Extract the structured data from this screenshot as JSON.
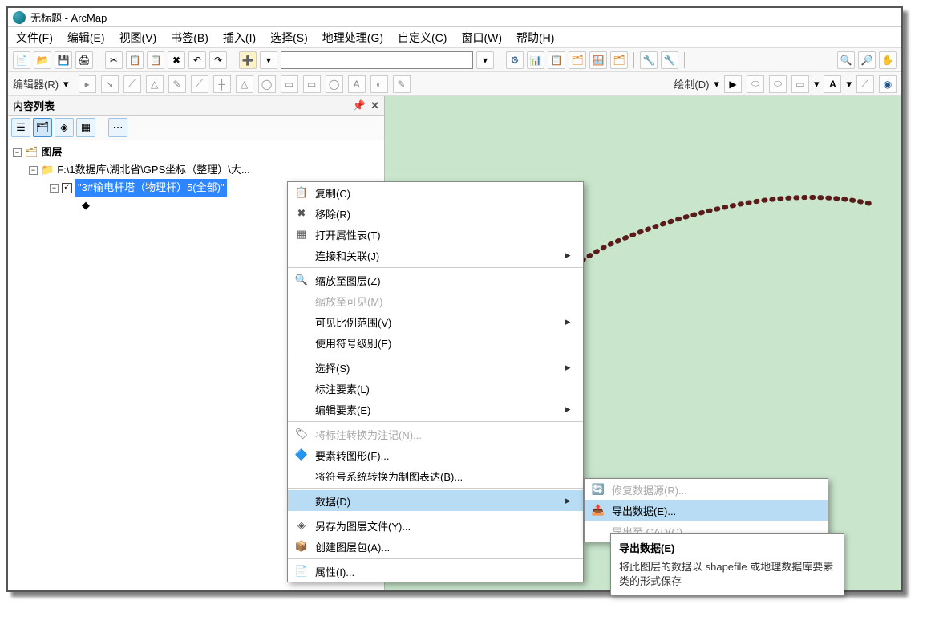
{
  "title": "无标题 - ArcMap",
  "menubar": [
    "文件(F)",
    "编辑(E)",
    "视图(V)",
    "书签(B)",
    "插入(I)",
    "选择(S)",
    "地理处理(G)",
    "自定义(C)",
    "窗口(W)",
    "帮助(H)"
  ],
  "toolbar1": {
    "btns": [
      "📄",
      "📂",
      "💾",
      "🖨",
      "✂",
      "📋",
      "📋",
      "✖",
      "↶",
      "↷",
      "➕",
      "",
      "",
      "",
      "⚙",
      "📊",
      "📋",
      "🗂",
      "🪟",
      "🗂",
      "🔧",
      "🔧",
      "",
      "",
      "🔍",
      "🔎"
    ],
    "scale_box": ""
  },
  "toolbar2": {
    "editor_label": "编辑器(R)",
    "draw_label": "绘制(D)",
    "mid_btns": [
      "▸",
      "↘",
      "⟋",
      "△",
      "✎",
      "⟋",
      "⟋",
      "┼",
      "△",
      "◯",
      "▭",
      "▭",
      "A",
      "◐",
      "✎",
      "□",
      "A"
    ]
  },
  "sidebar": {
    "title": "内容列表",
    "pin": "📌",
    "close": "✕",
    "tree": {
      "root": "图层",
      "path": "F:\\1数据库\\湖北省\\GPS坐标（整理）\\大...",
      "layer": "\"3#输电杆塔（物理杆）5(全部)\""
    }
  },
  "context_menu": {
    "items": [
      {
        "icon": "📋",
        "label": "复制(C)",
        "arrow": false,
        "disabled": false
      },
      {
        "icon": "✖",
        "label": "移除(R)",
        "arrow": false,
        "disabled": false
      },
      {
        "icon": "▦",
        "label": "打开属性表(T)",
        "arrow": false,
        "disabled": false
      },
      {
        "icon": "",
        "label": "连接和关联(J)",
        "arrow": true,
        "disabled": false
      },
      {
        "icon": "🔍",
        "label": "缩放至图层(Z)",
        "arrow": false,
        "disabled": false
      },
      {
        "icon": "",
        "label": "缩放至可见(M)",
        "arrow": false,
        "disabled": true
      },
      {
        "icon": "",
        "label": "可见比例范围(V)",
        "arrow": true,
        "disabled": false
      },
      {
        "icon": "",
        "label": "使用符号级别(E)",
        "arrow": false,
        "disabled": false
      },
      {
        "icon": "",
        "label": "选择(S)",
        "arrow": true,
        "disabled": false
      },
      {
        "icon": "",
        "label": "标注要素(L)",
        "arrow": false,
        "disabled": false
      },
      {
        "icon": "",
        "label": "编辑要素(E)",
        "arrow": true,
        "disabled": false
      },
      {
        "icon": "🏷",
        "label": "将标注转换为注记(N)...",
        "arrow": false,
        "disabled": true
      },
      {
        "icon": "🔷",
        "label": "要素转图形(F)...",
        "arrow": false,
        "disabled": false
      },
      {
        "icon": "",
        "label": "将符号系统转换为制图表达(B)...",
        "arrow": false,
        "disabled": false
      },
      {
        "icon": "",
        "label": "数据(D)",
        "arrow": true,
        "disabled": false,
        "selected": true
      },
      {
        "icon": "◈",
        "label": "另存为图层文件(Y)...",
        "arrow": false,
        "disabled": false
      },
      {
        "icon": "📦",
        "label": "创建图层包(A)...",
        "arrow": false,
        "disabled": false
      },
      {
        "icon": "📄",
        "label": "属性(I)...",
        "arrow": false,
        "disabled": false
      }
    ]
  },
  "submenu": {
    "items": [
      {
        "icon": "🔄",
        "label": "修复数据源(R)...",
        "disabled": true
      },
      {
        "icon": "📤",
        "label": "导出数据(E)...",
        "selected": true
      },
      {
        "icon": "",
        "label": "导出至 CAD(C)...",
        "disabled": true
      }
    ]
  },
  "tooltip": {
    "title": "导出数据(E)",
    "body": "将此图层的数据以 shapefile 或地理数据库要素类的形式保存"
  }
}
